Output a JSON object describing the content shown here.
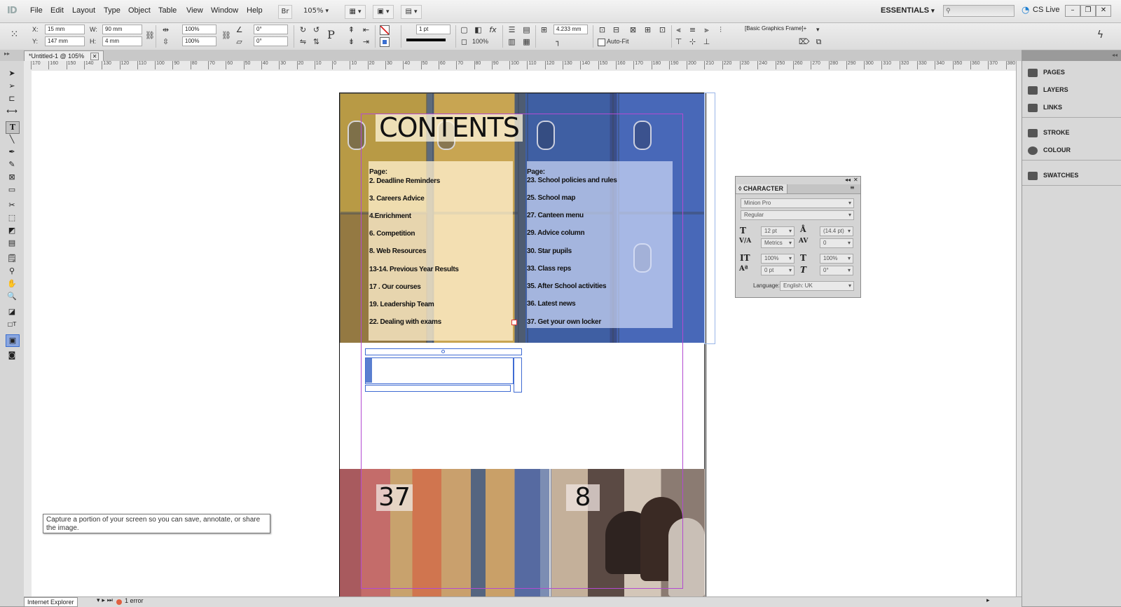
{
  "menubar": {
    "app_icon": "ID",
    "items": [
      "File",
      "Edit",
      "Layout",
      "Type",
      "Object",
      "Table",
      "View",
      "Window",
      "Help"
    ],
    "bridge": "Br",
    "zoom": "105%",
    "workspace": "ESSENTIALS",
    "cs_live": "CS Live"
  },
  "control": {
    "x_label": "X:",
    "x_value": "15 mm",
    "y_label": "Y:",
    "y_value": "147 mm",
    "w_label": "W:",
    "w_value": "90 mm",
    "h_label": "H:",
    "h_value": "4 mm",
    "scale_x": "100%",
    "scale_y": "100%",
    "rotate": "0°",
    "shear": "0°",
    "stroke_weight": "1 pt",
    "opacity": "100%",
    "spacing": "4.233 mm",
    "auto_fit": "Auto-Fit",
    "object_style": "[Basic Graphics Frame]+"
  },
  "document": {
    "tab": "*Untitled-1 @ 105%"
  },
  "ruler": [
    "170",
    "160",
    "150",
    "140",
    "130",
    "120",
    "110",
    "100",
    "90",
    "80",
    "70",
    "60",
    "50",
    "40",
    "30",
    "20",
    "10",
    "0",
    "10",
    "20",
    "30",
    "40",
    "50",
    "60",
    "70",
    "80",
    "90",
    "100",
    "110",
    "120",
    "130",
    "140",
    "150",
    "160",
    "170",
    "180",
    "190",
    "200",
    "210",
    "220",
    "230",
    "240",
    "250",
    "260",
    "270",
    "280",
    "290",
    "300",
    "310",
    "320",
    "330",
    "340",
    "350",
    "360",
    "370",
    "380"
  ],
  "page": {
    "title": "CONTENTS",
    "left_column": [
      "Page:",
      "2. Deadline Reminders",
      "3. Careers Advice",
      "4.Enrichment",
      "6. Competition",
      "8. Web Resources",
      "13-14. Previous Year Results",
      "17 . Our courses",
      "19. Leadership Team",
      "22. Dealing with exams"
    ],
    "right_column": [
      "Page:",
      "23. School policies and rules",
      "25. School map",
      "27. Canteen menu",
      "29. Advice column",
      "30. Star pupils",
      "33. Class reps",
      "35. After School activities",
      "36. Latest news",
      "37. Get your own locker"
    ],
    "page_number_left": "37",
    "page_number_right": "8"
  },
  "panels": {
    "items": [
      "PAGES",
      "LAYERS",
      "LINKS",
      "STROKE",
      "COLOUR",
      "SWATCHES"
    ]
  },
  "character": {
    "title": "CHARACTER",
    "font": "Minion Pro",
    "style": "Regular",
    "size": "12 pt",
    "leading": "(14.4 pt)",
    "kerning": "Metrics",
    "tracking": "0",
    "vscale": "100%",
    "hscale": "100%",
    "baseline": "0 pt",
    "skew": "0°",
    "language_label": "Language:",
    "language": "English: UK"
  },
  "tooltip": {
    "text": "Capture a portion of your screen so you can save, annotate, or share the image."
  },
  "statusbar": {
    "browser": "Internet Explorer",
    "errors": "1 error"
  },
  "colors": {
    "guide": "#b34ad1",
    "frame": "#3f6bd3",
    "accent": "#1e7fd1"
  }
}
